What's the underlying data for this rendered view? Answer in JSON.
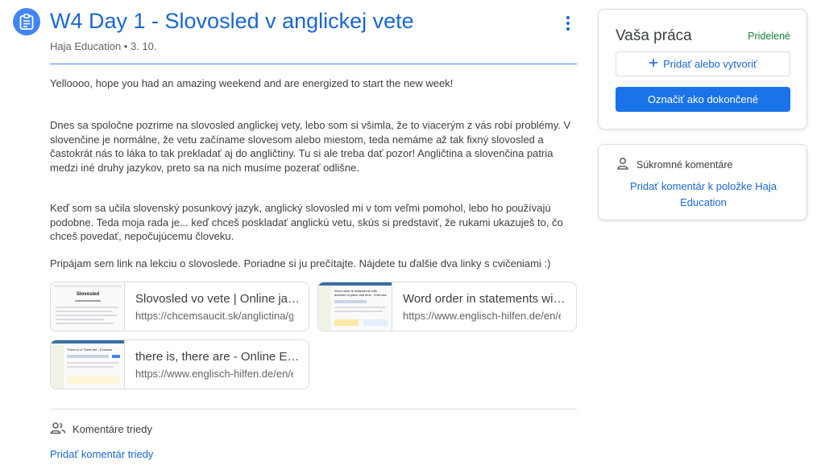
{
  "colors": {
    "accent_blue": "#1967d2",
    "icon_blue": "#4285f4",
    "button_blue": "#1a73e8",
    "status_green": "#188038",
    "text": "#3c4043",
    "muted": "#5f6368",
    "border": "#dadce0"
  },
  "assignment": {
    "icon": "assignment-icon",
    "title": "W4 Day 1 - Slovosled v anglickej vete",
    "author": "Haja Education",
    "separator": "•",
    "date": "3. 10.",
    "paragraphs": [
      "Yelloooo, hope you had an amazing weekend and are energized to start the new week!",
      "Dnes sa spoločne pozrime na slovosled anglickej vety, lebo som si všimla, že to viacerým z vás robí problémy. V slovenčine je normálne, že vetu začíname slovesom alebo miestom, teda nemáme až tak fixný slovosled a častokrát nás to láka to tak prekladať aj do angličtiny. Tu si ale treba dať pozor! Angličtina a slovenčina patria medzi  iné druhy jazykov, preto sa na nich musíme pozerať odlišne.",
      "Keď som sa učila slovenský posunkový jazyk, anglický slovosled mi v tom veľmi pomohol, lebo ho používajú podobne. Teda moja rada je... keď chceš poskladať anglickú vetu, skús si predstaviť, že rukami ukazuješ to, čo chceš povedať, nepočujúcemu človeku.",
      "Pripájam sem link na lekciu o slovoslede. Poriadne si ju prečítajte. Nájdete tu ďalšie dva linky s cvičeniami :)"
    ],
    "links": [
      {
        "title": "Slovosled vo vete | Online jazykové kurzy",
        "url": "https://chcemsaucit.sk/anglictina/gramatika",
        "thumb_heading": "Slovosled"
      },
      {
        "title": "Word order in statements with adverbs",
        "url": "https://www.englisch-hilfen.de/en/exercises",
        "thumb_heading": "Word order in statements with adverbs of place and time - Exercise"
      },
      {
        "title": "there is, there are - Online Exercise",
        "url": "https://www.englisch-hilfen.de/en/exercises",
        "thumb_heading": "There is or There are - Exercise"
      }
    ],
    "class_comments": {
      "icon": "people-icon",
      "label": "Komentáre triedy",
      "add_label": "Pridať komentár triedy"
    }
  },
  "your_work": {
    "title": "Vaša práca",
    "status": "Pridelené",
    "add_label": "Pridať alebo vytvoriť",
    "add_icon": "plus-icon",
    "mark_done_label": "Označiť ako dokončené"
  },
  "private_comments": {
    "icon": "person-icon",
    "label": "Súkromné komentáre",
    "add_label": "Pridať komentár k položke Haja Education"
  }
}
